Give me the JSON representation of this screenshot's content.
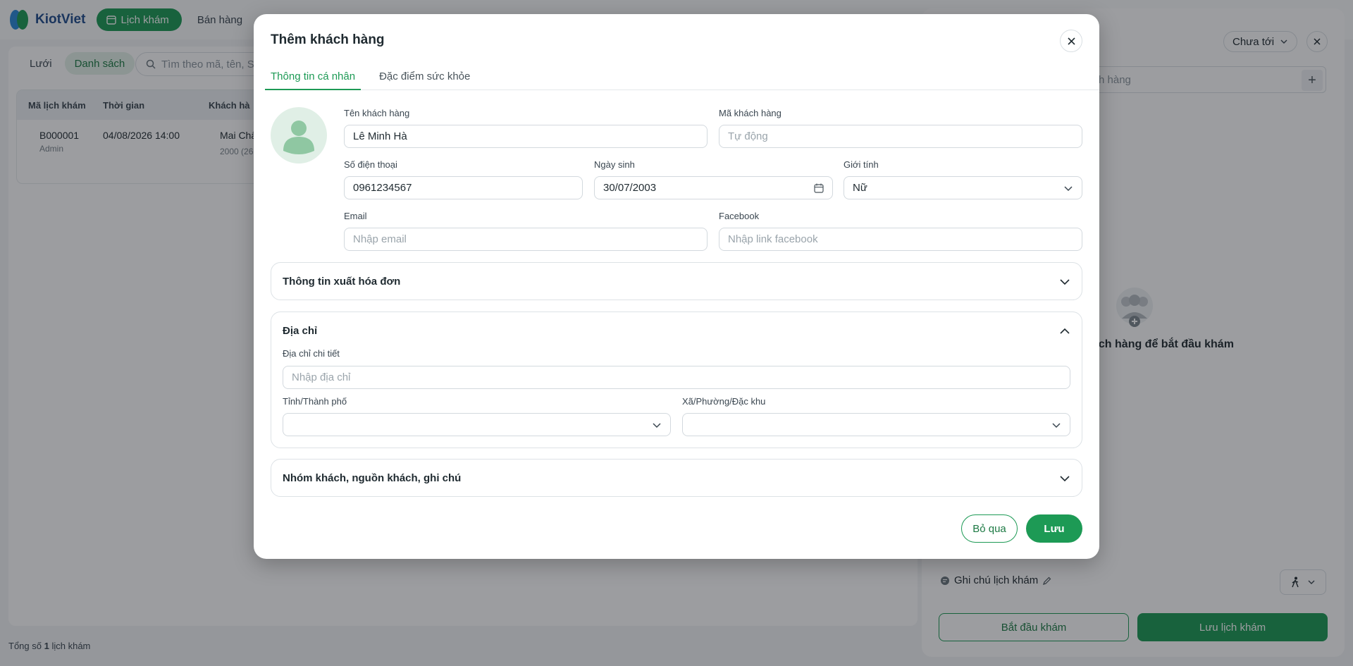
{
  "app": {
    "brand": "KiotViet",
    "nav_active": "Lịch khám",
    "nav_other": "Bán hàng"
  },
  "list": {
    "view_grid": "Lưới",
    "view_list": "Danh sách",
    "search_placeholder": "Tìm theo mã, tên, S",
    "columns": [
      "Mã lịch khám",
      "Thời gian",
      "Khách hà"
    ],
    "row": {
      "code": "B000001",
      "creator": "Admin",
      "time": "04/08/2026 14:00",
      "customer": "Mai Chấ",
      "customer_sub": "2000 (26"
    },
    "total_prefix": "Tổng số",
    "total_count": "1",
    "total_suffix": "lịch khám"
  },
  "side_panel": {
    "status": "Chưa tới",
    "search_placeholder": "h hàng",
    "empty_text": "ách hàng để bắt đầu khám",
    "note_label": "Ghi chú lịch khám",
    "start_button": "Bắt đầu khám",
    "save_button": "Lưu lịch khám"
  },
  "modal": {
    "title": "Thêm khách hàng",
    "tabs": [
      "Thông tin cá nhân",
      "Đặc điểm sức khỏe"
    ],
    "fields": {
      "name_label": "Tên khách hàng",
      "name_value": "Lê Minh Hà",
      "code_label": "Mã khách hàng",
      "code_placeholder": "Tự động",
      "phone_label": "Số điện thoại",
      "phone_value": "0961234567",
      "dob_label": "Ngày sinh",
      "dob_value": "30/07/2003",
      "gender_label": "Giới tính",
      "gender_value": "Nữ",
      "email_label": "Email",
      "email_placeholder": "Nhập email",
      "facebook_label": "Facebook",
      "facebook_placeholder": "Nhập link facebook"
    },
    "sections": {
      "invoice_title": "Thông tin xuất hóa đơn",
      "address_title": "Địa chỉ",
      "address_detail_label": "Địa chỉ chi tiết",
      "address_detail_placeholder": "Nhập địa chỉ",
      "province_label": "Tỉnh/Thành phố",
      "ward_label": "Xã/Phường/Đặc khu",
      "group_title": "Nhóm khách, nguồn khách, ghi chú"
    },
    "buttons": {
      "skip": "Bỏ qua",
      "save": "Lưu"
    }
  },
  "colors": {
    "accent": "#1d9a55",
    "overlay": "#14161c"
  }
}
